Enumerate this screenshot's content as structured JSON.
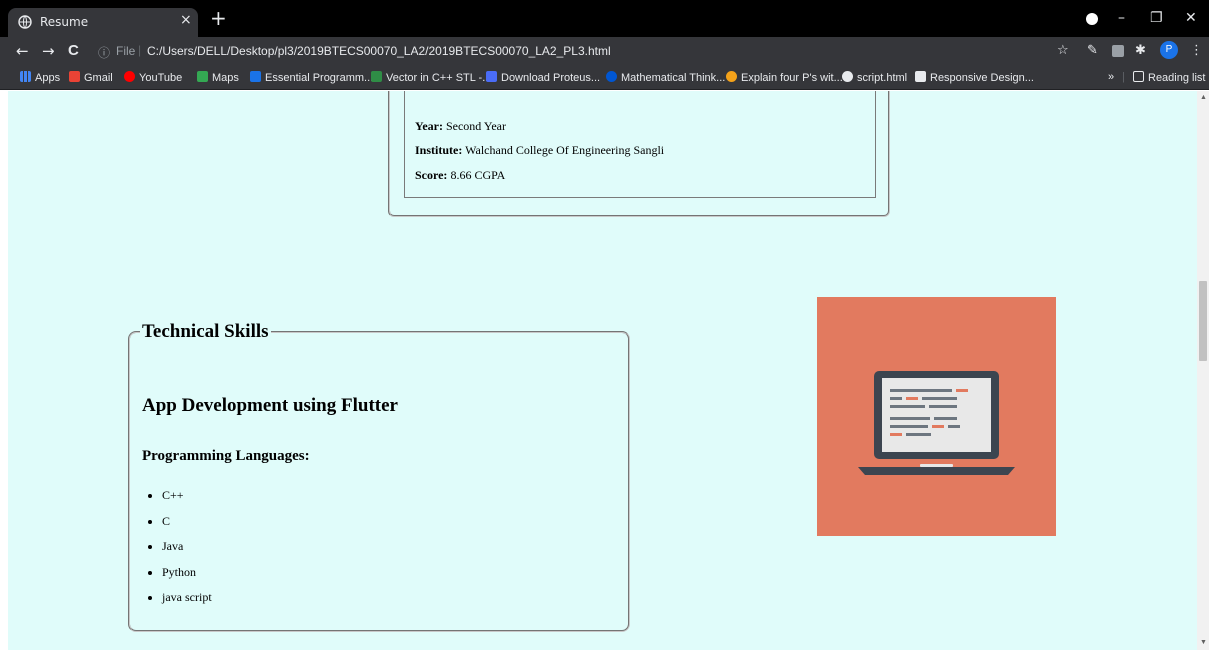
{
  "browser": {
    "tab_title": "Resume",
    "tab_close": "×",
    "new_tab": "+",
    "nav": {
      "back": "←",
      "forward": "→",
      "reload": "C"
    },
    "address": {
      "info_icon": "ⓘ",
      "scheme_label": "File",
      "separator": "|",
      "url": "C:/Users/DELL/Desktop/pl3/2019BTECS00070_LA2/2019BTECS00070_LA2_PL3.html"
    },
    "profile_initial": "P",
    "window_controls": {
      "minimize": "–",
      "restore": "❐",
      "close": "✕"
    },
    "bookmarks": [
      {
        "label": "Apps",
        "icon": "apps-grid-icon",
        "color": "#4285f4"
      },
      {
        "label": "Gmail",
        "icon": "gmail-icon",
        "color": "#ea4335"
      },
      {
        "label": "YouTube",
        "icon": "youtube-icon",
        "color": "#ff0000"
      },
      {
        "label": "Maps",
        "icon": "maps-icon",
        "color": "#34a853"
      },
      {
        "label": "Essential Programm...",
        "icon": "pb-icon",
        "color": "#1a73e8",
        "badge": "PB"
      },
      {
        "label": "Vector in C++ STL -...",
        "icon": "gfg-icon",
        "color": "#2f8d46"
      },
      {
        "label": "Download Proteus...",
        "icon": "proteus-icon",
        "color": "#4a6cf7"
      },
      {
        "label": "Mathematical Think...",
        "icon": "coursera-icon",
        "color": "#0056d2"
      },
      {
        "label": "Explain four P's wit...",
        "icon": "question-icon",
        "color": "#f4a21a"
      },
      {
        "label": "script.html",
        "icon": "globe-icon",
        "color": "#e8eaed"
      },
      {
        "label": "Responsive Design...",
        "icon": "responsive-icon",
        "color": "#e8eaed"
      }
    ],
    "more_bookmarks": "»",
    "reading_list": "Reading list"
  },
  "education": {
    "year_label": "Year:",
    "year_value": "Second Year",
    "institute_label": "Institute:",
    "institute_value": "Walchand College Of Engineering Sangli",
    "score_label": "Score:",
    "score_value": "8.66 CGPA"
  },
  "skills": {
    "legend": "Technical Skills",
    "heading": "App Development using Flutter",
    "subheading": "Programming Languages:",
    "languages": [
      "C++",
      "C",
      "Java",
      "Python",
      "java script"
    ]
  },
  "image": {
    "description_icon": "laptop-code-illustration",
    "bg_color": "#e27a5f"
  }
}
